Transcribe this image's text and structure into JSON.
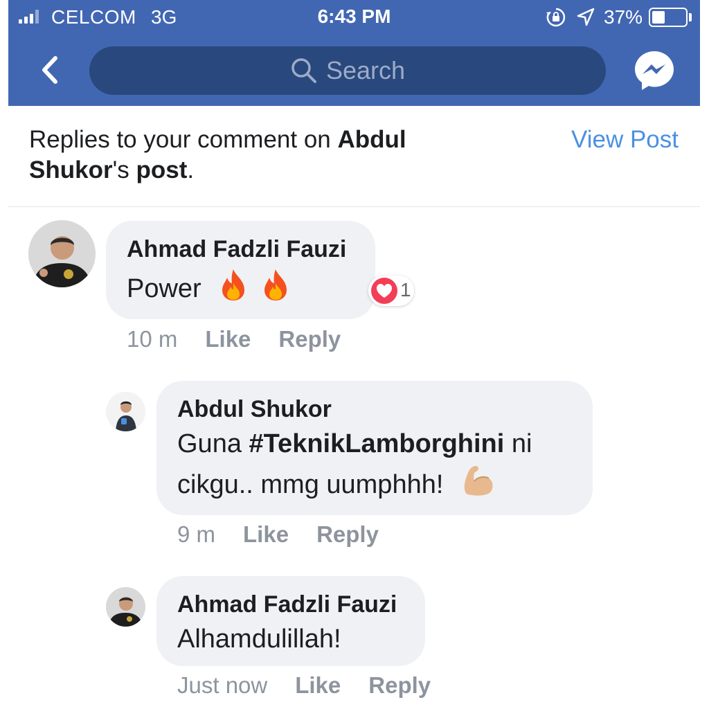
{
  "status_bar": {
    "carrier": "CELCOM",
    "network": "3G",
    "time": "6:43 PM",
    "battery": "37%"
  },
  "nav": {
    "search_placeholder": "Search",
    "icons": [
      "back-chevron-icon",
      "search-icon",
      "messenger-icon"
    ]
  },
  "notice": {
    "prefix": "Replies to your comment on ",
    "author": "Abdul Shukor",
    "possessive": "'s ",
    "post": "post",
    "suffix": ".",
    "view_post": "View Post"
  },
  "comments": [
    {
      "author": "Ahmad Fadzli Fauzi",
      "text": "Power",
      "emoji": [
        "fire",
        "fire"
      ],
      "time": "10 m",
      "like": "Like",
      "reply": "Reply",
      "reaction": {
        "type": "love",
        "count": "1"
      }
    },
    {
      "author": "Abdul Shukor",
      "text_before": "Guna ",
      "hashtag": "#TeknikLamborghini",
      "text_after": " ni cikgu.. mmg uumphhh!",
      "emoji": [
        "flexed-biceps"
      ],
      "time": "9 m",
      "like": "Like",
      "reply": "Reply"
    },
    {
      "author": "Ahmad Fadzli Fauzi",
      "text": "Alhamdulillah!",
      "time": "Just now",
      "like": "Like",
      "reply": "Reply"
    }
  ],
  "colors": {
    "header": "#4267b2",
    "search_field": "#29487d",
    "link": "#4a90e2",
    "bubble": "#f0f1f4",
    "meta": "#8d949e",
    "love": "#f33e58"
  }
}
